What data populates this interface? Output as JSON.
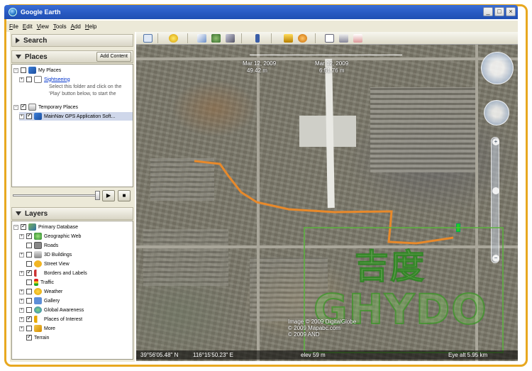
{
  "window": {
    "title": "Google Earth",
    "controls": [
      "_",
      "□",
      "×"
    ]
  },
  "menu": [
    "File",
    "Edit",
    "View",
    "Tools",
    "Add",
    "Help"
  ],
  "search": {
    "label": "Search"
  },
  "places": {
    "label": "Places",
    "add_content": "Add Content",
    "items": [
      {
        "label": "My Places",
        "checked": false
      },
      {
        "label": "Sightseeing",
        "checked": false,
        "desc": "Select this folder and click on the 'Play' button below, to start the"
      },
      {
        "label": "Temporary Places",
        "checked": true
      },
      {
        "label": "MainNav GPS Application Soft...",
        "checked": true
      }
    ]
  },
  "layers": {
    "label": "Layers",
    "items": [
      {
        "label": "Primary Database",
        "checked": true
      },
      {
        "label": "Geographic Web",
        "checked": true
      },
      {
        "label": "Roads",
        "checked": false
      },
      {
        "label": "3D Buildings",
        "checked": false
      },
      {
        "label": "Street View",
        "checked": false
      },
      {
        "label": "Borders and Labels",
        "checked": true
      },
      {
        "label": "Traffic",
        "checked": false
      },
      {
        "label": "Weather",
        "checked": false
      },
      {
        "label": "Gallery",
        "checked": false
      },
      {
        "label": "Global Awareness",
        "checked": false
      },
      {
        "label": "Places of Interest",
        "checked": true
      },
      {
        "label": "More",
        "checked": false
      },
      {
        "label": "Terrain",
        "checked": true
      }
    ]
  },
  "map": {
    "ruler_a_date": "Mar 12, 2009",
    "ruler_a_alt": "49.42 m",
    "ruler_b_date": "Mar 12, 2009",
    "ruler_b_alt": "6:51.76 m",
    "copyright": [
      "Image © 2009 DigitalGlobe",
      "© 2009 Mapabc.com",
      "© 2009 AND"
    ],
    "watermark_cn": "吉度",
    "watermark_en": "GHYDO",
    "route_color": "#e8892a"
  },
  "status": {
    "lat": "39°56'05.48\" N",
    "lon": "116°15'50.23\" E",
    "elev": "elev 59 m",
    "eye_alt": "Eye alt  5.95 km"
  },
  "colors": {
    "frame": "#e8a820",
    "titlebar": "#2a5bc4",
    "panel": "#ece9d8"
  }
}
